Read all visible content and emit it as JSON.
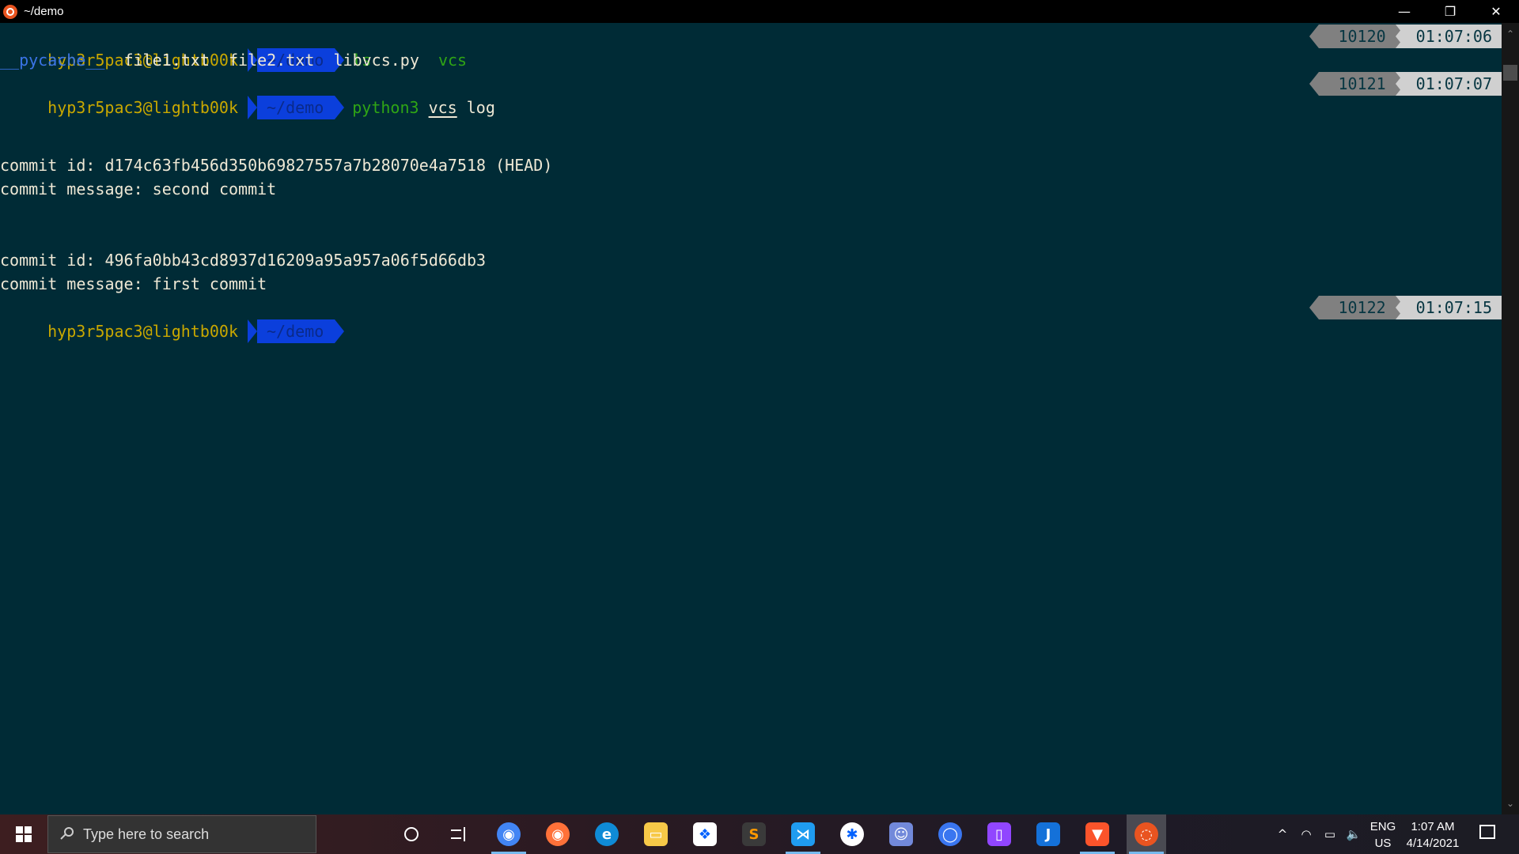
{
  "window": {
    "title": "~/demo",
    "controls": {
      "minimize": "—",
      "restore": "❐",
      "close": "✕"
    }
  },
  "terminal": {
    "prompts": [
      {
        "user": "hyp3r5pac3@lightb00k",
        "path": "~/demo",
        "command": "ls",
        "args": "",
        "history_num": "10120",
        "time": "01:07:06"
      },
      {
        "user": "hyp3r5pac3@lightb00k",
        "path": "~/demo",
        "command": "python3",
        "args_underlined": "vcs",
        "args": "log",
        "history_num": "10121",
        "time": "01:07:07"
      },
      {
        "user": "hyp3r5pac3@lightb00k",
        "path": "~/demo",
        "command": "",
        "args": "",
        "history_num": "10122",
        "time": "01:07:15"
      }
    ],
    "ls_output": [
      {
        "name": "__pycache__",
        "type": "dir"
      },
      {
        "name": "file1.txt",
        "type": "file"
      },
      {
        "name": "file2.txt",
        "type": "file"
      },
      {
        "name": "libvcs.py",
        "type": "file"
      },
      {
        "name": "vcs",
        "type": "exec"
      }
    ],
    "log_output": [
      "commit id: d174c63fb456d350b69827557a7b28070e4a7518 (HEAD)",
      "commit message: second commit",
      "commit id: 496fa0bb43cd8937d16209a95a957a06f5d66db3",
      "commit message: first commit"
    ]
  },
  "scrollbar": {
    "up": "⌃",
    "down": "⌄"
  },
  "taskbar": {
    "search_placeholder": "Type here to search",
    "apps": [
      {
        "name": "chrome",
        "glyph": "◉",
        "color": "#4285f4",
        "running": true
      },
      {
        "name": "firefox",
        "glyph": "◉",
        "color": "#ff7139",
        "running": false
      },
      {
        "name": "edge",
        "glyph": "e",
        "color": "#0f8bd6",
        "running": false
      },
      {
        "name": "file-explorer",
        "glyph": "▭",
        "color": "#f7c948",
        "running": false
      },
      {
        "name": "dropbox",
        "glyph": "❖",
        "color": "#ffffff",
        "running": false
      },
      {
        "name": "sublime-text",
        "glyph": "S",
        "color": "#3a3a3a",
        "running": false
      },
      {
        "name": "vscode",
        "glyph": "⋊",
        "color": "#1f9cf0",
        "running": true
      },
      {
        "name": "slack",
        "glyph": "✱",
        "color": "#ffffff",
        "running": false
      },
      {
        "name": "discord",
        "glyph": "☺",
        "color": "#7289da",
        "running": false
      },
      {
        "name": "signal",
        "glyph": "◯",
        "color": "#3a76f0",
        "running": false
      },
      {
        "name": "twitch",
        "glyph": "▯",
        "color": "#9146ff",
        "running": false
      },
      {
        "name": "joplin",
        "glyph": "J",
        "color": "#1471d9",
        "running": false
      },
      {
        "name": "brave",
        "glyph": "▼",
        "color": "#fb542b",
        "running": true
      },
      {
        "name": "ubuntu-terminal",
        "glyph": "◌",
        "color": "#e95420",
        "running": true,
        "active": true
      }
    ],
    "tray": {
      "chevron": "^",
      "wifi": "◠",
      "battery": "▭",
      "volume": "🔈",
      "language_top": "ENG",
      "language_bottom": "US",
      "time": "1:07 AM",
      "date": "4/14/2021"
    }
  }
}
